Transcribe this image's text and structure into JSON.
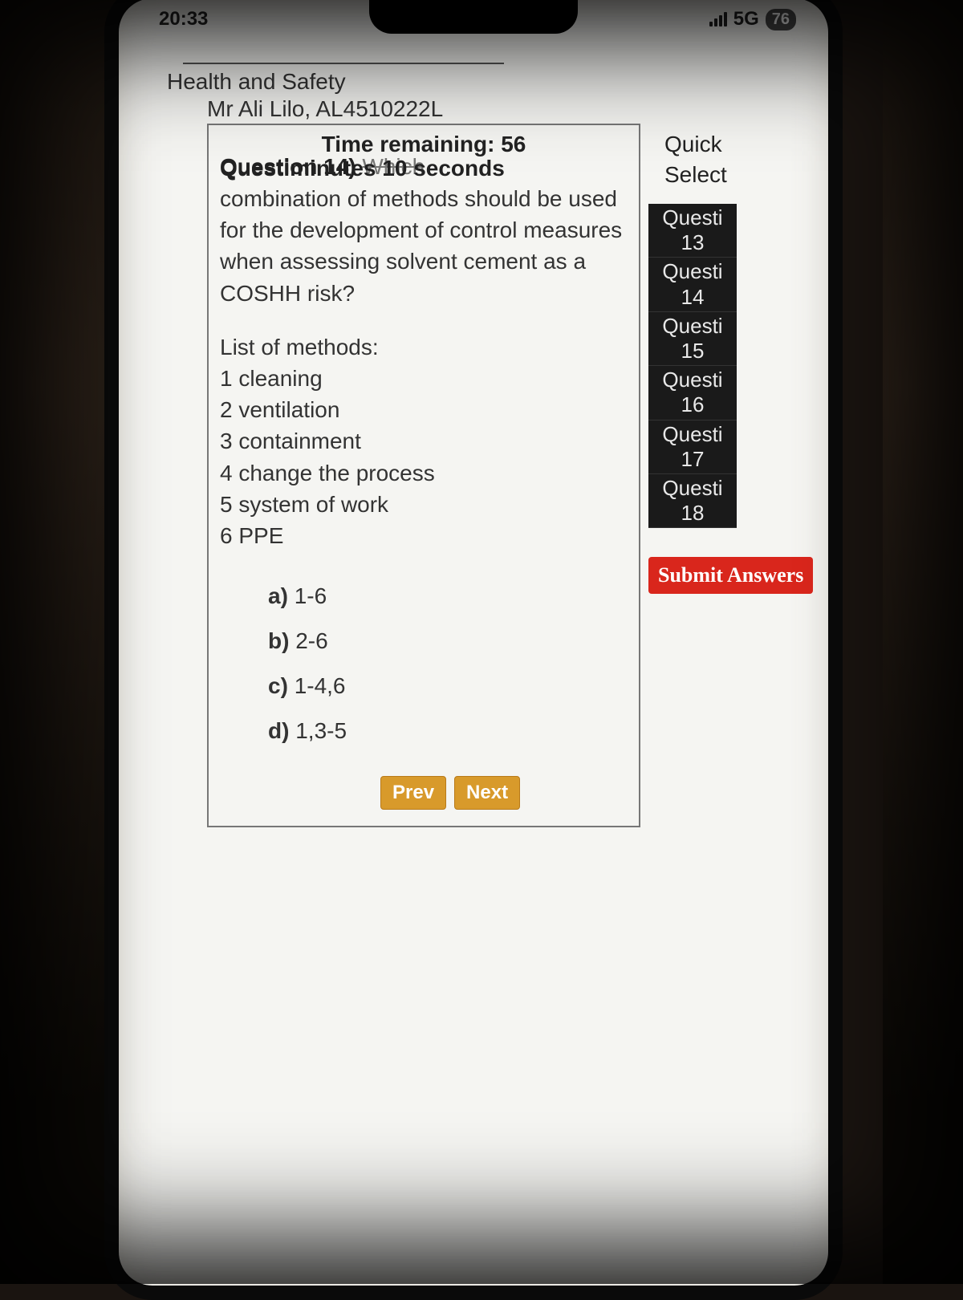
{
  "status": {
    "time": "20:33",
    "network": "5G",
    "battery": "76"
  },
  "header": {
    "title": "Health and Safety",
    "user": "Mr Ali Lilo, AL4510222L"
  },
  "timer": {
    "label": "Time remaining:",
    "value": "56 minutes 10 seconds"
  },
  "question": {
    "number_label": "Question 14)",
    "prompt_word": "Which",
    "text": "combination of methods should be used for the development of control measures when assessing solvent cement as a COSHH risk?",
    "methods_title": "List of methods:",
    "methods": [
      "1 cleaning",
      "2 ventilation",
      "3 containment",
      "4 change the process",
      "5 system of work",
      "6 PPE"
    ],
    "answers": [
      {
        "letter": "a)",
        "text": "1-6"
      },
      {
        "letter": "b)",
        "text": "2-6"
      },
      {
        "letter": "c)",
        "text": "1-4,6"
      },
      {
        "letter": "d)",
        "text": "1,3-5"
      }
    ]
  },
  "nav": {
    "prev": "Prev",
    "next": "Next"
  },
  "quick": {
    "title1": "Quick",
    "title2": "Select",
    "items": [
      {
        "label": "Questi",
        "num": "13"
      },
      {
        "label": "Questi",
        "num": "14"
      },
      {
        "label": "Questi",
        "num": "15"
      },
      {
        "label": "Questi",
        "num": "16"
      },
      {
        "label": "Questi",
        "num": "17"
      },
      {
        "label": "Questi",
        "num": "18"
      }
    ]
  },
  "submit": {
    "label": "Submit Answers"
  }
}
